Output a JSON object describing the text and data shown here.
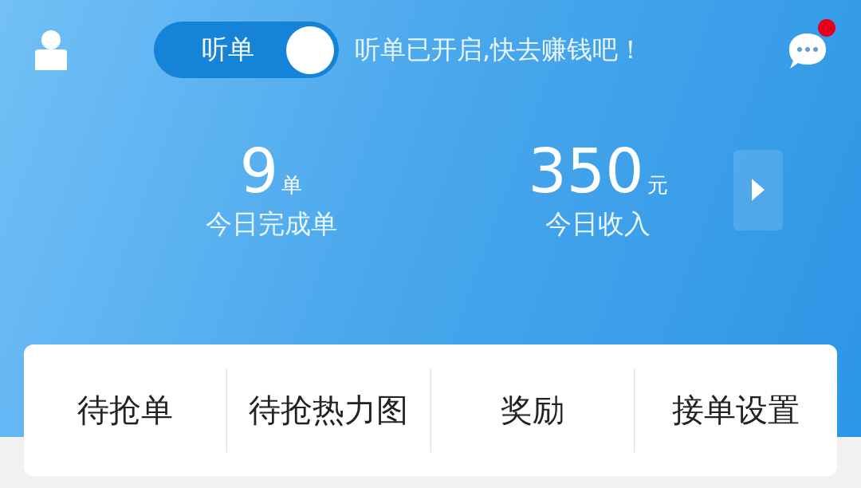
{
  "header": {
    "listen_toggle": {
      "label": "听单",
      "on": true
    },
    "status_message": "听单已开启,快去赚钱吧！",
    "messages": {
      "unread": true
    }
  },
  "stats": [
    {
      "value": "9",
      "unit": "单",
      "label": "今日完成单"
    },
    {
      "value": "350",
      "unit": "元",
      "label": "今日收入"
    }
  ],
  "menu": [
    {
      "label": "待抢单"
    },
    {
      "label": "待抢热力图"
    },
    {
      "label": "奖励"
    },
    {
      "label": "接单设置"
    }
  ]
}
